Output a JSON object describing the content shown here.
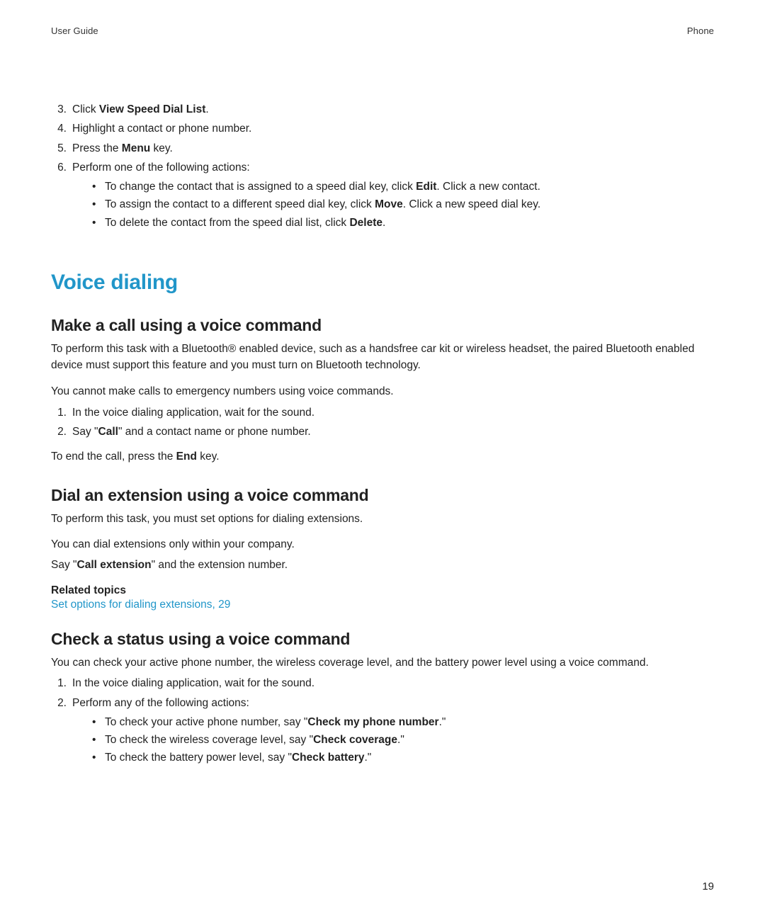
{
  "header": {
    "left": "User Guide",
    "right": "Phone"
  },
  "prev_steps": {
    "start": 3,
    "items": [
      {
        "prefix": "Click ",
        "bold": "View Speed Dial List",
        "suffix": "."
      },
      {
        "text": "Highlight a contact or phone number."
      },
      {
        "prefix": "Press the ",
        "bold": "Menu",
        "suffix": " key."
      },
      {
        "text": "Perform one of the following actions:",
        "sub": [
          {
            "prefix": "To change the contact that is assigned to a speed dial key, click ",
            "bold": "Edit",
            "suffix": ". Click a new contact."
          },
          {
            "prefix": "To assign the contact to a different speed dial key, click ",
            "bold": "Move",
            "suffix": ". Click a new speed dial key."
          },
          {
            "prefix": "To delete the contact from the speed dial list, click ",
            "bold": "Delete",
            "suffix": "."
          }
        ]
      }
    ]
  },
  "section_title": "Voice dialing",
  "topic1": {
    "title": "Make a call using a voice command",
    "p1": "To perform this task with a Bluetooth® enabled device, such as a handsfree car kit or wireless headset, the paired Bluetooth enabled device must support this feature and you must turn on Bluetooth technology.",
    "p2": "You cannot make calls to emergency numbers using voice commands.",
    "steps": [
      {
        "text": "In the voice dialing application, wait for the sound."
      },
      {
        "prefix": "Say \"",
        "bold": "Call",
        "suffix": "\" and a contact name or phone number."
      }
    ],
    "p3_prefix": "To end the call, press the ",
    "p3_bold": "End",
    "p3_suffix": " key."
  },
  "topic2": {
    "title": "Dial an extension using a voice command",
    "p1": "To perform this task, you must set options for dialing extensions.",
    "p2": "You can dial extensions only within your company.",
    "p3_prefix": "Say \"",
    "p3_bold": "Call extension",
    "p3_suffix": "\" and the extension number.",
    "related_heading": "Related topics",
    "related_link": "Set options for dialing extensions, 29"
  },
  "topic3": {
    "title": "Check a status using a voice command",
    "p1": "You can check your active phone number, the wireless coverage level, and the battery power level using a voice command.",
    "steps": [
      {
        "text": "In the voice dialing application, wait for the sound."
      },
      {
        "text": "Perform any of the following actions:",
        "sub": [
          {
            "prefix": "To check your active phone number, say \"",
            "bold": "Check my phone number",
            "suffix": ".\""
          },
          {
            "prefix": "To check the wireless coverage level, say \"",
            "bold": "Check coverage",
            "suffix": ".\""
          },
          {
            "prefix": "To check the battery power level, say \"",
            "bold": "Check battery",
            "suffix": ".\""
          }
        ]
      }
    ]
  },
  "page_number": "19"
}
